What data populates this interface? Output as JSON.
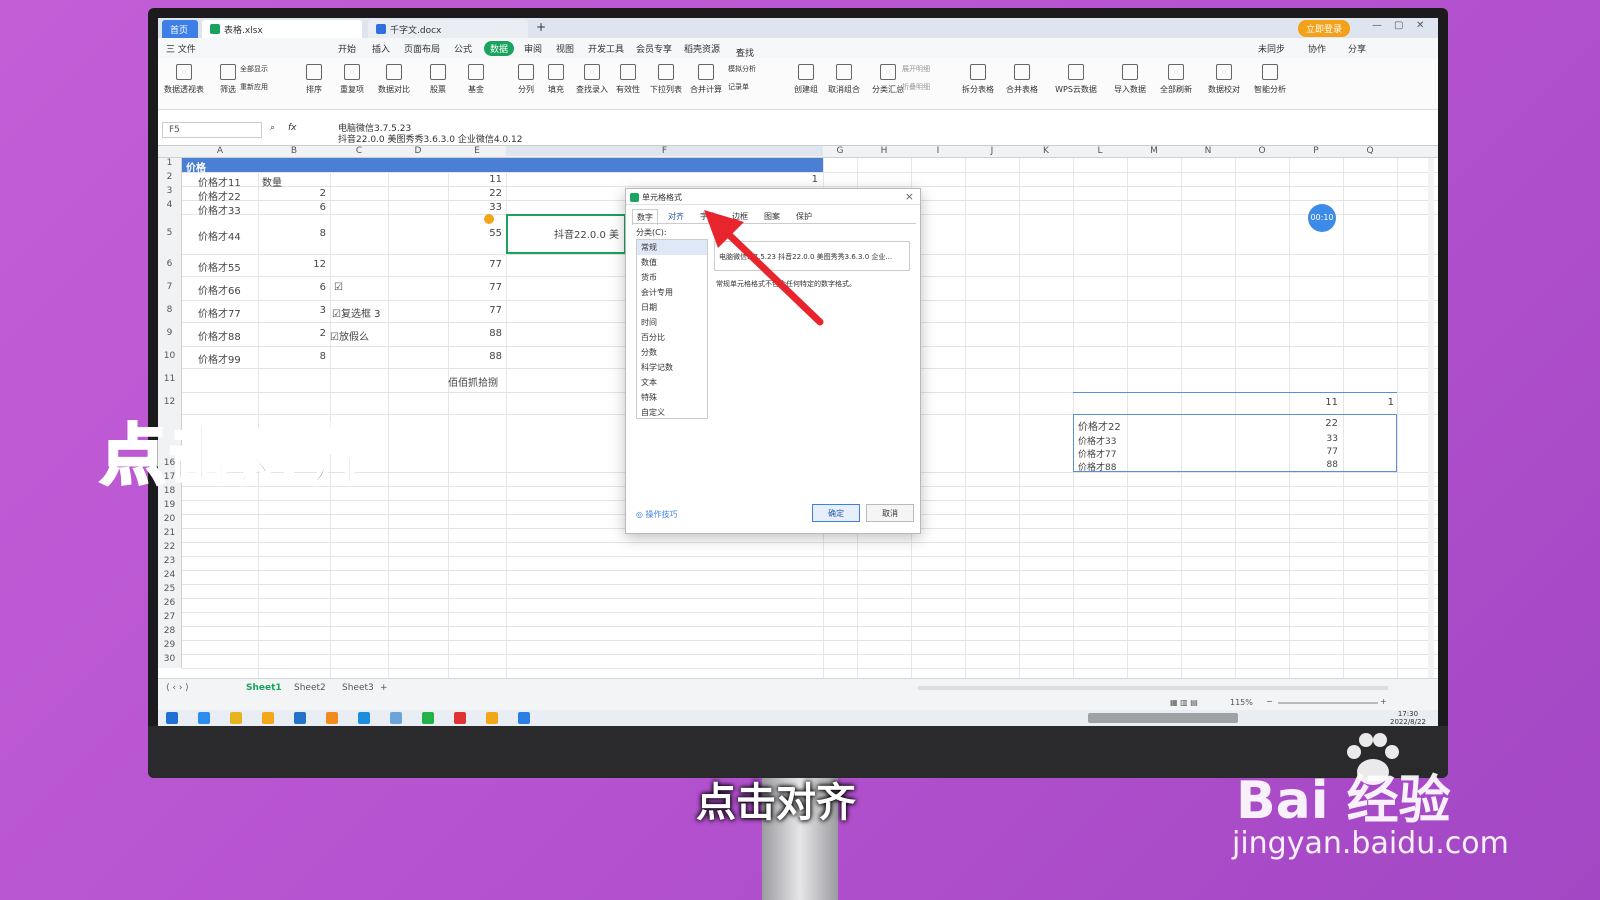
{
  "colors": {
    "accent_green": "#1aa35c",
    "accent_blue": "#3d7fe6",
    "header_band": "#4a7fd4",
    "arrow": "#e8252d",
    "background": "#b653d0"
  },
  "window": {
    "home_tab": "首页",
    "tabs": [
      {
        "label": "表格.xlsx"
      },
      {
        "label": "千字文.docx"
      }
    ],
    "new_tab": "+",
    "login": "立即登录"
  },
  "menu": {
    "file": "三 文件",
    "items": [
      "开始",
      "插入",
      "页面布局",
      "公式",
      "数据",
      "审阅",
      "视图",
      "开发工具",
      "会员专享",
      "稻壳资源"
    ],
    "active": "数据",
    "search": "查找命令、搜索模板",
    "sync": "未同步",
    "collab": "协作",
    "share": "分享"
  },
  "ribbon": {
    "buttons": [
      "数据透视表",
      "筛选",
      "排序",
      "重复项",
      "数据对比",
      "股票",
      "基金",
      "分列",
      "填充",
      "查找录入",
      "有效性",
      "下拉列表",
      "合并计算",
      "记录单",
      "创建组",
      "取消组合",
      "分类汇总",
      "展开明细",
      "拆分表格",
      "合并表格",
      "WPS云数据",
      "导入数据",
      "全部刷新",
      "数据校对",
      "智能分析"
    ],
    "small": [
      "全部显示",
      "重新应用",
      "模拟分析",
      "折叠明细"
    ]
  },
  "formula_bar": {
    "cell_ref": "F5",
    "fx": "fx",
    "line1": "电脑微信3.7.5.23",
    "line2": "抖音22.0.0 美图秀秀3.6.3.0 企业微信4.0.12"
  },
  "columns": [
    "A",
    "B",
    "C",
    "D",
    "E",
    "F",
    "G",
    "H",
    "I",
    "J",
    "K",
    "L",
    "M",
    "N",
    "O",
    "P",
    "Q"
  ],
  "rows": [
    "1",
    "2",
    "3",
    "4",
    "5",
    "6",
    "7",
    "8",
    "9",
    "10",
    "11",
    "12",
    "16",
    "17",
    "18",
    "19",
    "20",
    "21",
    "22",
    "23",
    "24",
    "25",
    "26",
    "27",
    "28",
    "29",
    "30"
  ],
  "cells": {
    "a1": "价格",
    "a2": "价格才11",
    "b2": "数量",
    "e2": "11",
    "f2": "1",
    "a3": "价格才22",
    "b3": "2",
    "e3": "22",
    "a4": "价格才33",
    "b4": "6",
    "e4": "33",
    "a5": "价格才44",
    "b5": "8",
    "e5": "55",
    "f5": "抖音22.0.0 美",
    "a6": "价格才55",
    "b6": "12",
    "e6": "77",
    "a7": "价格才66",
    "b7": "6",
    "e7": "77",
    "a8": "价格才77",
    "b8": "3",
    "c8": "复选框 3",
    "e8": "77",
    "a9": "价格才88",
    "b9": "2",
    "c9": "放假么",
    "e9": "88",
    "a10": "价格才99",
    "b10": "8",
    "e10": "88",
    "e11": "佰佰抓拾捌",
    "p12": "11",
    "q12": "1",
    "l13": "价格才22",
    "p13": "22",
    "l14": "价格才33",
    "p14": "33",
    "l15": "价格才77",
    "p15": "77",
    "l16": "价格才88",
    "p16": "88"
  },
  "sheets": {
    "names": [
      "Sheet1",
      "Sheet2",
      "Sheet3"
    ],
    "add": "+"
  },
  "status": {
    "zoom": "115%",
    "minus": "−",
    "plus": "+"
  },
  "clock": {
    "time": "17:30",
    "date": "2022/8/22"
  },
  "timer": "00:10",
  "dialog": {
    "title": "单元格格式",
    "tabs": [
      "数字",
      "对齐",
      "字体",
      "边框",
      "图案",
      "保护"
    ],
    "category_label": "分类(C):",
    "categories": [
      "常规",
      "数值",
      "货币",
      "会计专用",
      "日期",
      "时间",
      "百分比",
      "分数",
      "科学记数",
      "文本",
      "特殊",
      "自定义"
    ],
    "sample": "电脑微信3.7.5.23 抖音22.0.0 美图秀秀3.6.3.0 企业...",
    "description": "常规单元格格式不包含任何特定的数字格式。",
    "tips": "操作技巧",
    "ok": "确定",
    "cancel": "取消"
  },
  "overlay_text": "点击对齐",
  "caption": "点击对齐",
  "watermark": {
    "brand": "Bai 经验",
    "url": "jingyan.baidu.com"
  }
}
